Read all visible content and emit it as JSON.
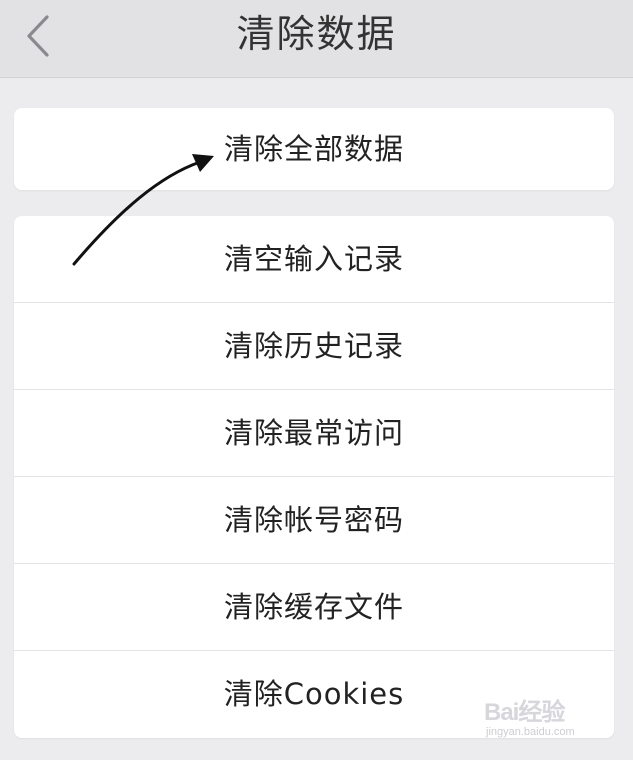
{
  "header": {
    "title": "清除数据",
    "back_icon": "chevron-left-icon"
  },
  "primary_action": {
    "label": "清除全部数据"
  },
  "list_items": [
    {
      "label": "清空输入记录"
    },
    {
      "label": "清除历史记录"
    },
    {
      "label": "清除最常访问"
    },
    {
      "label": "清除帐号密码"
    },
    {
      "label": "清除缓存文件"
    },
    {
      "label": "清除Cookies"
    }
  ],
  "watermark": {
    "brand": "Bai经验",
    "sub": "jingyan.baidu.com"
  },
  "colors": {
    "background": "#ececee",
    "nav_background": "#e2e2e4",
    "card": "#ffffff",
    "text": "#222222",
    "arrow": "#111111"
  }
}
